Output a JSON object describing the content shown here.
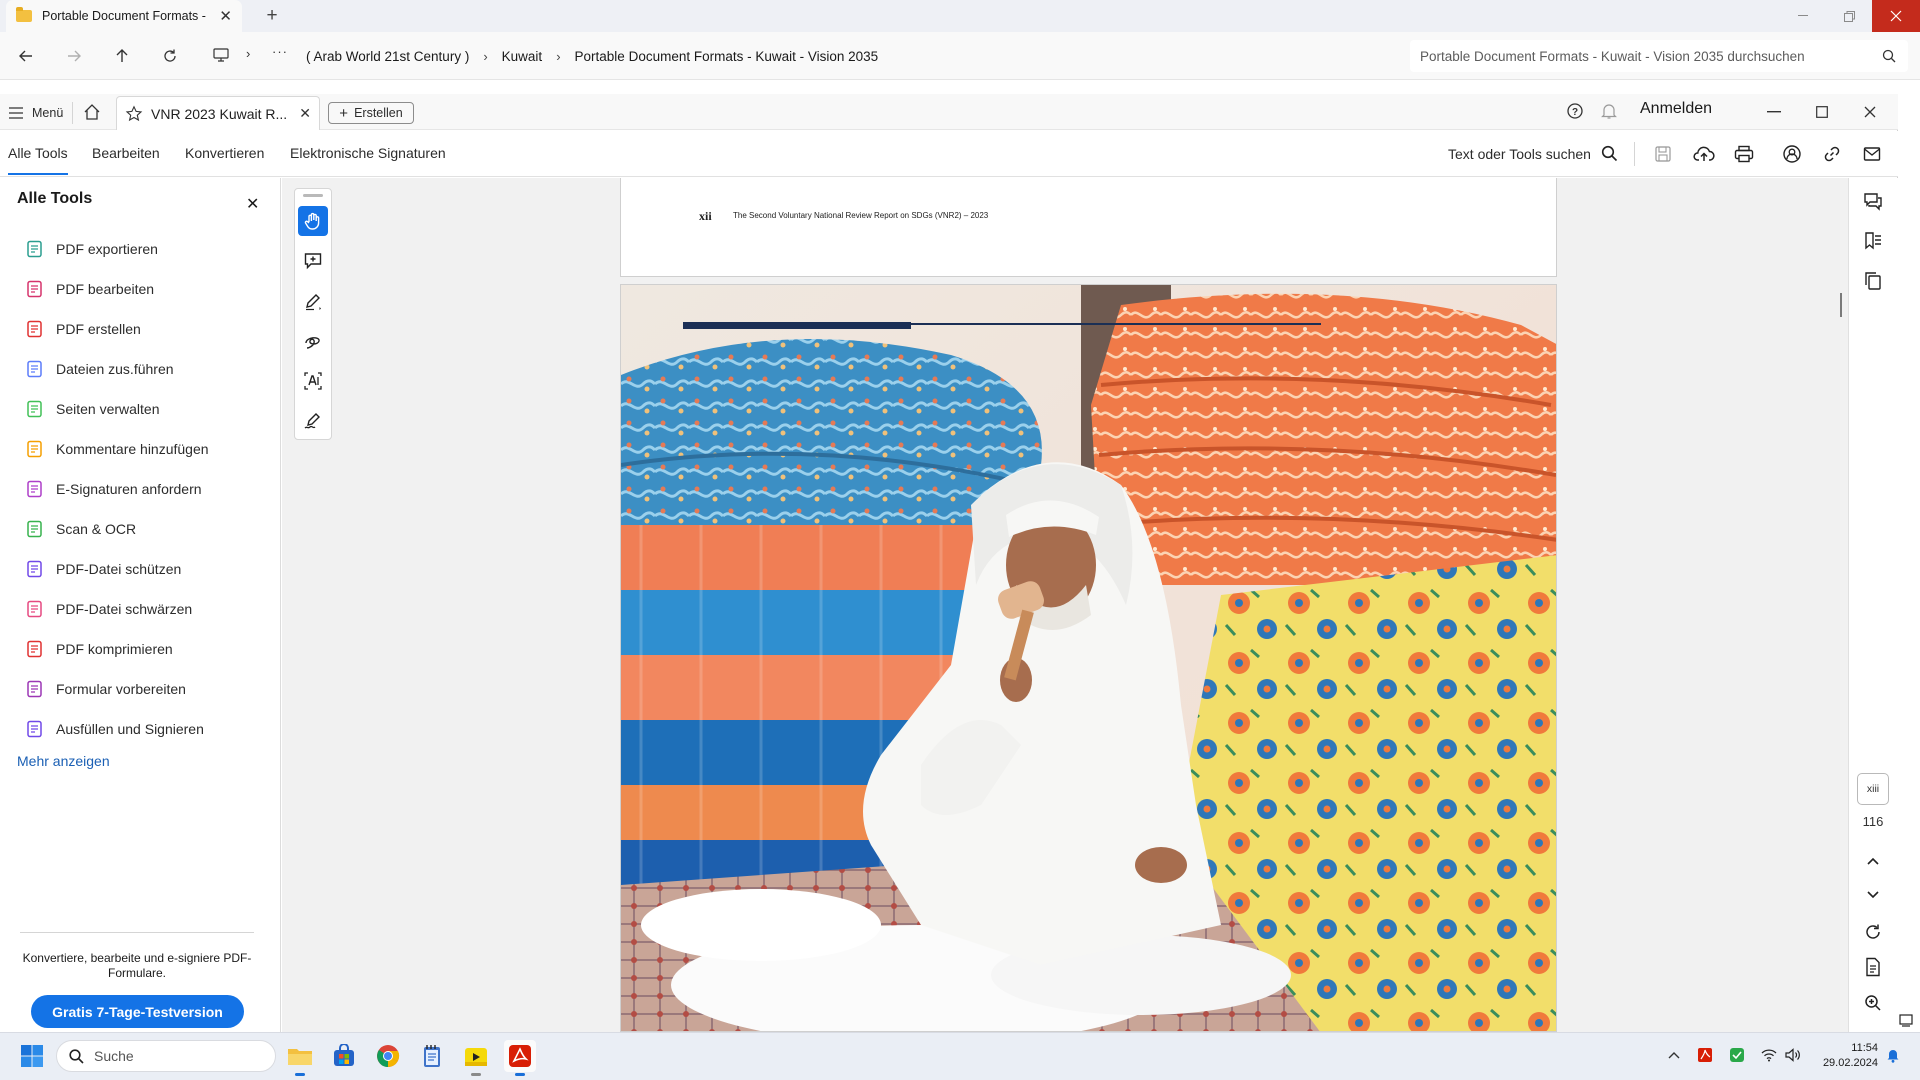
{
  "explorer": {
    "tab_title": "Portable Document Formats -",
    "breadcrumb": [
      "( Arab World 21st Century )",
      "Kuwait",
      "Portable Document Formats - Kuwait - Vision 2035"
    ],
    "search_placeholder": "Portable Document Formats - Kuwait - Vision 2035 durchsuchen",
    "controls": {
      "close_color": "#c42b1c"
    }
  },
  "acrobat": {
    "menu_label": "Menü",
    "doc_tab_title": "VNR 2023 Kuwait R...",
    "create_label": "Erstellen",
    "signin_label": "Anmelden",
    "nav": [
      "Alle Tools",
      "Bearbeiten",
      "Konvertieren",
      "Elektronische Signaturen"
    ],
    "search_tools_label": "Text oder Tools suchen",
    "accent_color": "#1473e6"
  },
  "tools_panel": {
    "title": "Alle Tools",
    "items": [
      {
        "label": "PDF exportieren",
        "icon": "export-pdf-icon",
        "color": "#2a9d8f"
      },
      {
        "label": "PDF bearbeiten",
        "icon": "edit-pdf-icon",
        "color": "#d6336c"
      },
      {
        "label": "PDF erstellen",
        "icon": "create-pdf-icon",
        "color": "#e03131"
      },
      {
        "label": "Dateien zus.führen",
        "icon": "combine-files-icon",
        "color": "#5c7cfa"
      },
      {
        "label": "Seiten verwalten",
        "icon": "organize-pages-icon",
        "color": "#40c057"
      },
      {
        "label": "Kommentare hinzufügen",
        "icon": "comment-icon",
        "color": "#f59f00"
      },
      {
        "label": "E-Signaturen anfordern",
        "icon": "request-esign-icon",
        "color": "#ae3ec9"
      },
      {
        "label": "Scan & OCR",
        "icon": "scan-ocr-icon",
        "color": "#37b24d"
      },
      {
        "label": "PDF-Datei schützen",
        "icon": "protect-pdf-icon",
        "color": "#7048e8"
      },
      {
        "label": "PDF-Datei schwärzen",
        "icon": "redact-pdf-icon",
        "color": "#e64980"
      },
      {
        "label": "PDF komprimieren",
        "icon": "compress-pdf-icon",
        "color": "#e03131"
      },
      {
        "label": "Formular vorbereiten",
        "icon": "prepare-form-icon",
        "color": "#9c36b5"
      },
      {
        "label": "Ausfüllen und Signieren",
        "icon": "fill-sign-icon",
        "color": "#7048e8"
      }
    ],
    "more_label": "Mehr anzeigen",
    "promo_text": "Konvertiere, bearbeite und e-signiere PDF-Formulare.",
    "trial_button": "Gratis 7-Tage-Testversion"
  },
  "document": {
    "page_number": "xii",
    "header_text": "The Second Voluntary National Review Report on SDGs (VNR2) – 2023",
    "current_page": "xiii",
    "total_pages": "116"
  },
  "taskbar": {
    "search_placeholder": "Suche",
    "time": "11:54",
    "date": "29.02.2024"
  }
}
